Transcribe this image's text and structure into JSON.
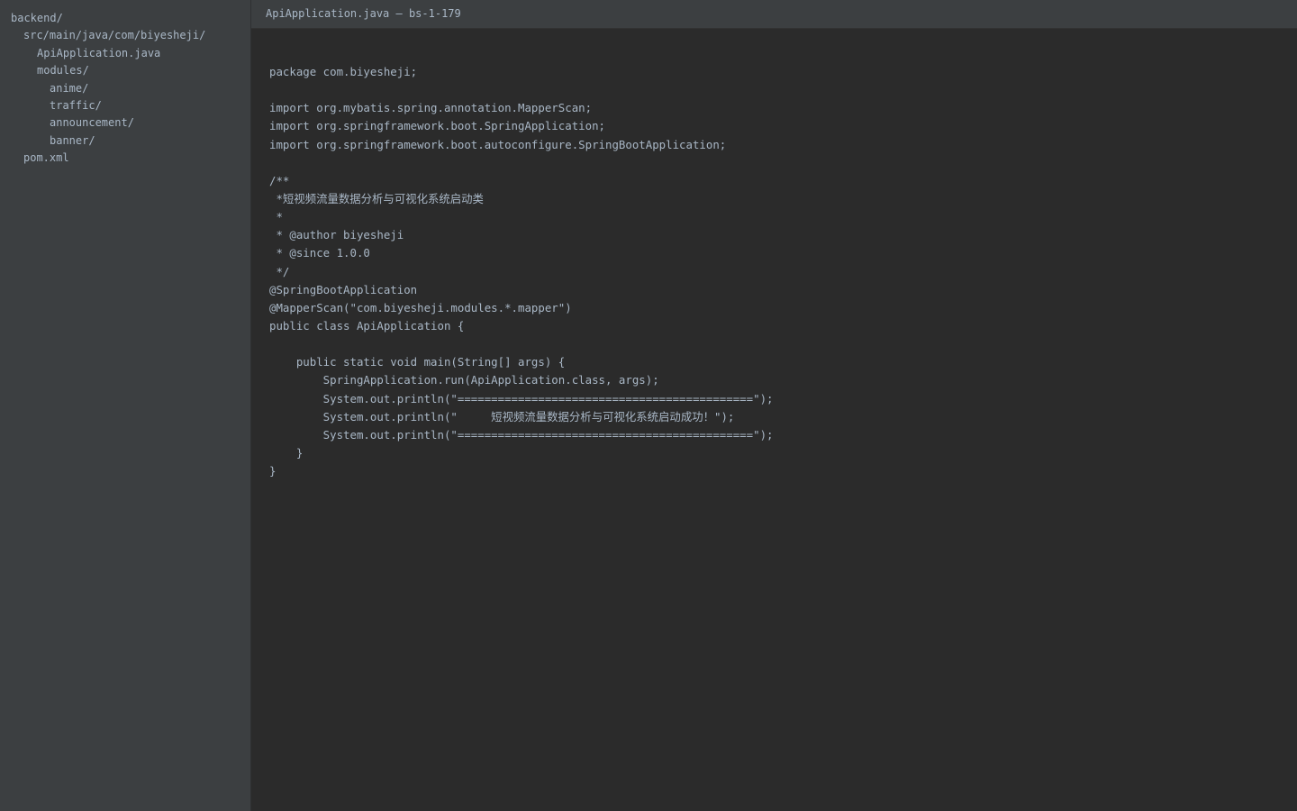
{
  "window": {
    "title": "ApiApplication.java — bs-1-179"
  },
  "sidebar": {
    "items": [
      {
        "label": "backend/",
        "depth": 0
      },
      {
        "label": "src/main/java/com/biyesheji/",
        "depth": 1
      },
      {
        "label": "ApiApplication.java",
        "depth": 2
      },
      {
        "label": "modules/",
        "depth": 2
      },
      {
        "label": "anime/",
        "depth": 3
      },
      {
        "label": "traffic/",
        "depth": 3
      },
      {
        "label": "announcement/",
        "depth": 3
      },
      {
        "label": "banner/",
        "depth": 3
      },
      {
        "label": "pom.xml",
        "depth": 1
      }
    ]
  },
  "editor": {
    "lines": [
      "package com.biyesheji;",
      "",
      "import org.mybatis.spring.annotation.MapperScan;",
      "import org.springframework.boot.SpringApplication;",
      "import org.springframework.boot.autoconfigure.SpringBootApplication;",
      "",
      "/**",
      " *短视频流量数据分析与可视化系统启动类",
      " *",
      " * @author biyesheji",
      " * @since 1.0.0",
      " */",
      "@SpringBootApplication",
      "@MapperScan(\"com.biyesheji.modules.*.mapper\")",
      "public class ApiApplication {",
      "",
      "    public static void main(String[] args) {",
      "        SpringApplication.run(ApiApplication.class, args);",
      "        System.out.println(\"============================================\");",
      "        System.out.println(\"     短视频流量数据分析与可视化系统启动成功！\");",
      "        System.out.println(\"============================================\");",
      "    }",
      "}"
    ]
  },
  "colors": {
    "sidebar_bg": "#3c3f41",
    "editor_bg": "#2b2b2b",
    "text": "#a9b7c6"
  }
}
